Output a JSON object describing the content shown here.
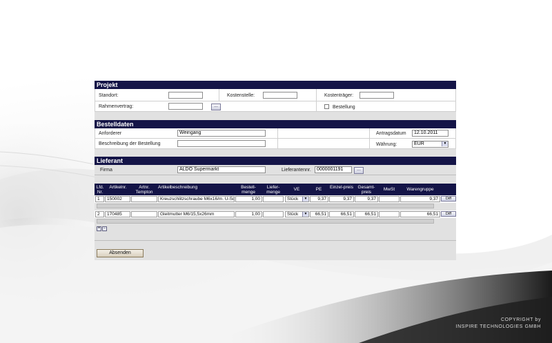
{
  "copyright": {
    "line1": "COPYRIGHT by",
    "line2": "INSPIRE TECHNOLOGIES GMBH"
  },
  "projekt": {
    "title": "Projekt",
    "standort_label": "Standort:",
    "standort_value": "",
    "kostenstelle_label": "Kostenstelle:",
    "kostenstelle_value": "",
    "kostentraeger_label": "Kostenträger:",
    "kostentraeger_value": "",
    "rahmenvertrag_label": "Rahmenvertrag:",
    "rahmenvertrag_value": "",
    "browse_label": "...",
    "bestellung_label": "Bestellung",
    "bestellung_checked": false
  },
  "bestelldaten": {
    "title": "Bestelldaten",
    "anforderer_label": "Anforderer",
    "anforderer_value": "Weingang",
    "beschreibung_label": "Beschreibung der Bestellung",
    "beschreibung_value": "",
    "antragsdatum_label": "Antragsdatum",
    "antragsdatum_value": "12.10.2011",
    "waehrung_label": "Währung:",
    "waehrung_value": "EUR"
  },
  "lieferant": {
    "title": "Lieferant",
    "firma_label": "Firma",
    "firma_value": "ALDO Supermarkt",
    "lieferantennr_label": "Lieferantennr.",
    "lieferantennr_value": "0000001191",
    "browse_label": "..."
  },
  "positions": {
    "headers": {
      "lfd": "Lfd. Nr.",
      "artikelnr": "Artikelnr.",
      "artnr_tempton": "Artnr. Tempton",
      "artikelbeschreibung": "Artikelbeschreibung",
      "bestellmenge": "Bestell-menge",
      "liefermenge": "Liefer-menge",
      "ve": "VE",
      "pe": "PE",
      "einzelpreis": "Einzel-preis",
      "gesamtpreis": "Gesamt-preis",
      "mwst": "MwSt",
      "warengruppe": "Warengruppe"
    },
    "rows": [
      {
        "lfd": "1",
        "artikelnr": "150002",
        "artnr_tempton": "",
        "beschreibung": "Kreuzschlitzschraube M6x16/m. U-Sc",
        "bestellmenge": "1,00",
        "liefermenge": "",
        "ve": "Stück",
        "pe": "9,37",
        "einzelpreis": "9,37",
        "gesamtpreis": "9,37",
        "mwst": "",
        "warengruppe": "9,37",
        "diff_label": "Diff"
      },
      {
        "lfd": "2",
        "artikelnr": "170485",
        "artnr_tempton": "",
        "beschreibung": "Gleitmutter  M6/15,5x26mm",
        "bestellmenge": "1,00",
        "liefermenge": "",
        "ve": "Stück",
        "pe": "66,51",
        "einzelpreis": "66,51",
        "gesamtpreis": "66,51",
        "mwst": "",
        "warengruppe": "66,51",
        "diff_label": "Diff"
      }
    ],
    "add_label": "+",
    "remove_label": "-"
  },
  "absenden_label": "Absenden",
  "colors": {
    "header_bg": "#141447",
    "panel_bg": "#e1e1e1"
  }
}
